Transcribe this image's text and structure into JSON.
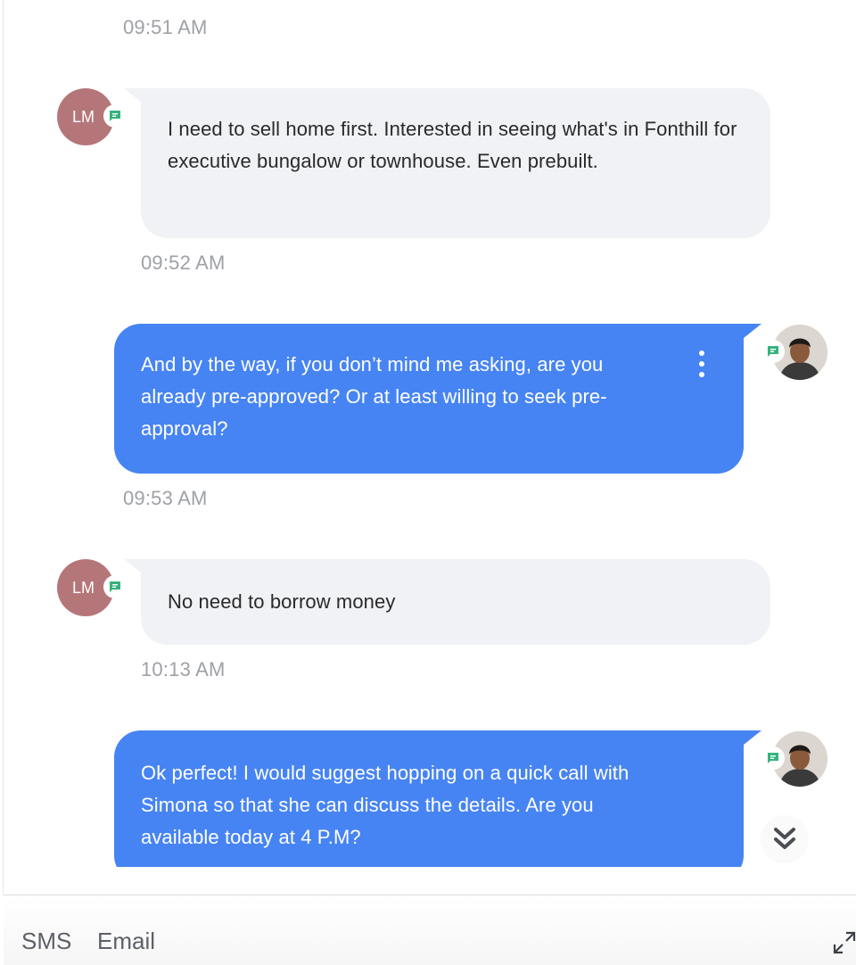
{
  "colors": {
    "outgoing_bubble": "#4784f3",
    "incoming_bubble": "#f1f2f5",
    "timestamp": "#9ea1a6",
    "contact_avatar": "#b5767a",
    "channel_badge": "#36b37e"
  },
  "thread": {
    "top_timestamp": "09:51 AM",
    "messages": [
      {
        "direction": "incoming",
        "avatar_initials": "LM",
        "channel_icon": "sms-chat-icon",
        "text": "I need to sell home first. Interested in seeing what's in Fonthill for executive bungalow or townhouse. Even prebuilt.",
        "timestamp": "09:52 AM"
      },
      {
        "direction": "outgoing",
        "avatar": "agent-photo",
        "channel_icon": "sms-chat-icon",
        "menu_icon": "more-vertical-icon",
        "text": "And by the way, if you don’t mind me asking, are you already pre-approved? Or at least willing to seek pre-approval?",
        "timestamp": "09:53 AM"
      },
      {
        "direction": "incoming",
        "avatar_initials": "LM",
        "channel_icon": "sms-chat-icon",
        "text": "No need to borrow money",
        "timestamp": "10:13 AM"
      },
      {
        "direction": "outgoing",
        "avatar": "agent-photo",
        "channel_icon": "sms-chat-icon",
        "text": "Ok perfect! I would suggest hopping on a quick call with Simona so that she can discuss the details. Are you available today at 4 P.M?"
      }
    ],
    "scroll_to_bottom_icon": "double-chevron-down-icon"
  },
  "composer": {
    "tabs": [
      {
        "label": "SMS"
      },
      {
        "label": "Email"
      }
    ],
    "expand_icon": "expand-icon"
  }
}
